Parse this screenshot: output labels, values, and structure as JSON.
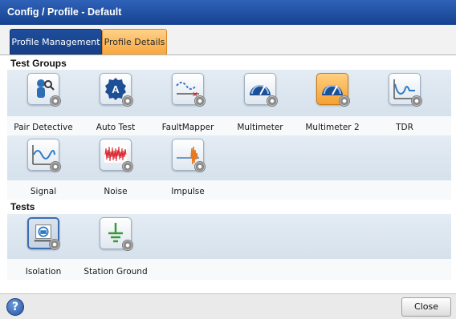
{
  "window": {
    "title": "Config / Profile - Default"
  },
  "tabs": [
    {
      "label": "Profile Management",
      "active": false
    },
    {
      "label": "Profile Details",
      "active": true
    }
  ],
  "test_groups": {
    "header": "Test Groups",
    "items": [
      {
        "label": "Pair Detective",
        "icon": "pair-detective-icon"
      },
      {
        "label": "Auto Test",
        "icon": "auto-test-icon"
      },
      {
        "label": "FaultMapper",
        "icon": "faultmapper-icon"
      },
      {
        "label": "Multimeter",
        "icon": "multimeter-icon"
      },
      {
        "label": "Multimeter 2",
        "icon": "multimeter-icon",
        "selected": true
      },
      {
        "label": "TDR",
        "icon": "tdr-icon"
      },
      {
        "label": "Signal",
        "icon": "signal-icon"
      },
      {
        "label": "Noise",
        "icon": "noise-icon"
      },
      {
        "label": "Impulse",
        "icon": "impulse-icon"
      }
    ]
  },
  "tests": {
    "header": "Tests",
    "items": [
      {
        "label": "Isolation",
        "icon": "isolation-icon",
        "pressed": true
      },
      {
        "label": "Station Ground",
        "icon": "ground-icon"
      }
    ]
  },
  "footer": {
    "help_label": "?",
    "close_label": "Close"
  },
  "colors": {
    "titlebar": "#1f4f9f",
    "active_tab": "#f7a63d",
    "row_band": "#dbe5ef"
  }
}
